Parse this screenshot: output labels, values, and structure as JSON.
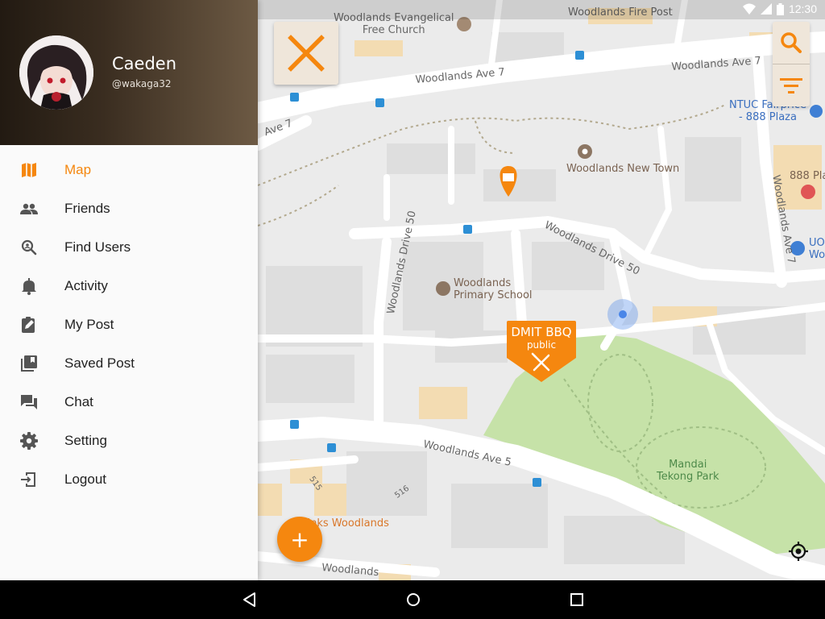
{
  "status_bar": {
    "time": "12:30"
  },
  "drawer": {
    "user_name": "Caeden",
    "user_handle": "@wakaga32",
    "menu": [
      {
        "label": "Map",
        "icon": "map-icon",
        "active": true
      },
      {
        "label": "Friends",
        "icon": "people-icon",
        "active": false
      },
      {
        "label": "Find Users",
        "icon": "user-search-icon",
        "active": false
      },
      {
        "label": "Activity",
        "icon": "bell-icon",
        "active": false
      },
      {
        "label": "My Post",
        "icon": "edit-post-icon",
        "active": false
      },
      {
        "label": "Saved Post",
        "icon": "library-icon",
        "active": false
      },
      {
        "label": "Chat",
        "icon": "chat-icon",
        "active": false
      },
      {
        "label": "Setting",
        "icon": "gear-icon",
        "active": false
      },
      {
        "label": "Logout",
        "icon": "logout-icon",
        "active": false
      }
    ]
  },
  "map": {
    "labels": {
      "church": "Woodlands Evangelical\nFree Church",
      "fire_post": "Woodlands Fire Post",
      "ave7_a": "Woodlands Ave 7",
      "ave7_b": "Woodlands Ave 7",
      "ave7_c": "Ave 7",
      "ntuc": "NTUC Fairprice\n- 888 Plaza",
      "new_town": "Woodlands New Town",
      "plaza888": "888 Pla",
      "drive50_a": "Woodlands Drive 50",
      "drive50_b": "Woodlands Drive 50",
      "ave_vertical": "Woodlands Ave 7",
      "uo": "UO\nWo",
      "school": "Woodlands\nPrimary School",
      "ave5": "Woodlands Ave 5",
      "park": "Mandai\nTekong Park",
      "block515": "515",
      "block516": "516",
      "kinks": "Kinks Woodlands",
      "bottom_road": "Woodlands"
    },
    "event_pin": {
      "title": "DMIT BBQ",
      "subtitle": "public"
    }
  },
  "controls": {
    "close": "close-icon",
    "search": "search-icon",
    "filter": "filter-icon",
    "add": "+",
    "locate": "my-location-icon"
  },
  "colors": {
    "accent": "#f5870f",
    "park": "#c6e2a8",
    "road": "#ffffff",
    "map_bg": "#ebebeb",
    "location_dot": "#4a86e8"
  }
}
